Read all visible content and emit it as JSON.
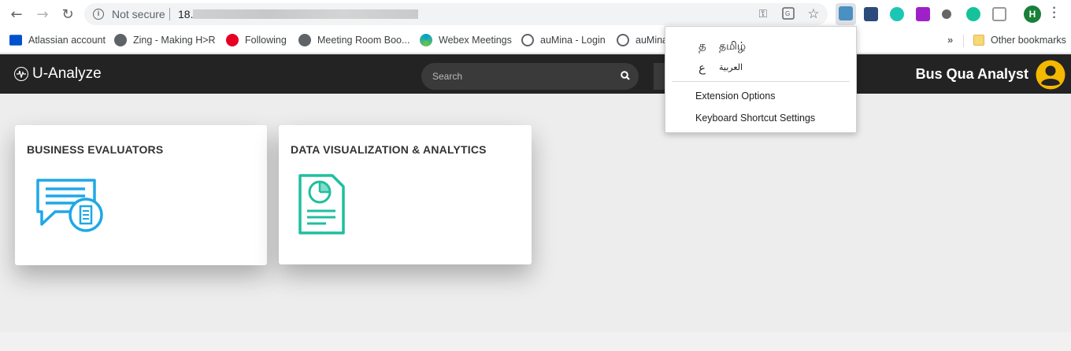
{
  "browser": {
    "url": {
      "security_label": "Not secure",
      "prefix": "18."
    },
    "bookmarks": [
      {
        "label": "Atlassian account",
        "color": "#0052cc"
      },
      {
        "label": "Zing - Making H>R",
        "color": "#5f6368"
      },
      {
        "label": "Following",
        "color": "#e60023"
      },
      {
        "label": "Meeting Room Boo...",
        "color": "#5f6368"
      },
      {
        "label": "Webex Meetings",
        "color": "#00a0d1"
      },
      {
        "label": "auMina - Login",
        "color": "#5f6368"
      },
      {
        "label": "auMina",
        "color": "#5f6368"
      }
    ],
    "more_bookmarks": "»",
    "other_bookmarks": "Other bookmarks",
    "profile_initial": "H"
  },
  "extension_menu": {
    "languages": [
      {
        "glyph": "த",
        "label": "தமிழ்"
      },
      {
        "glyph": "ع",
        "label": "العربية"
      }
    ],
    "options": [
      "Extension Options",
      "Keyboard Shortcut Settings"
    ]
  },
  "app": {
    "logo": "U-Analyze",
    "search_placeholder": "Search",
    "user_name": "Bus Qua Analyst",
    "colors": {
      "navbar": "#232323",
      "avatar": "#f5b800",
      "business_icon": "#1ea8e6",
      "dataviz_icon": "#1fbf9f"
    },
    "cards": [
      {
        "title": "BUSINESS EVALUATORS",
        "icon": "report-chat-icon"
      },
      {
        "title": "DATA VISUALIZATION & ANALYTICS",
        "icon": "pie-document-icon"
      }
    ]
  }
}
